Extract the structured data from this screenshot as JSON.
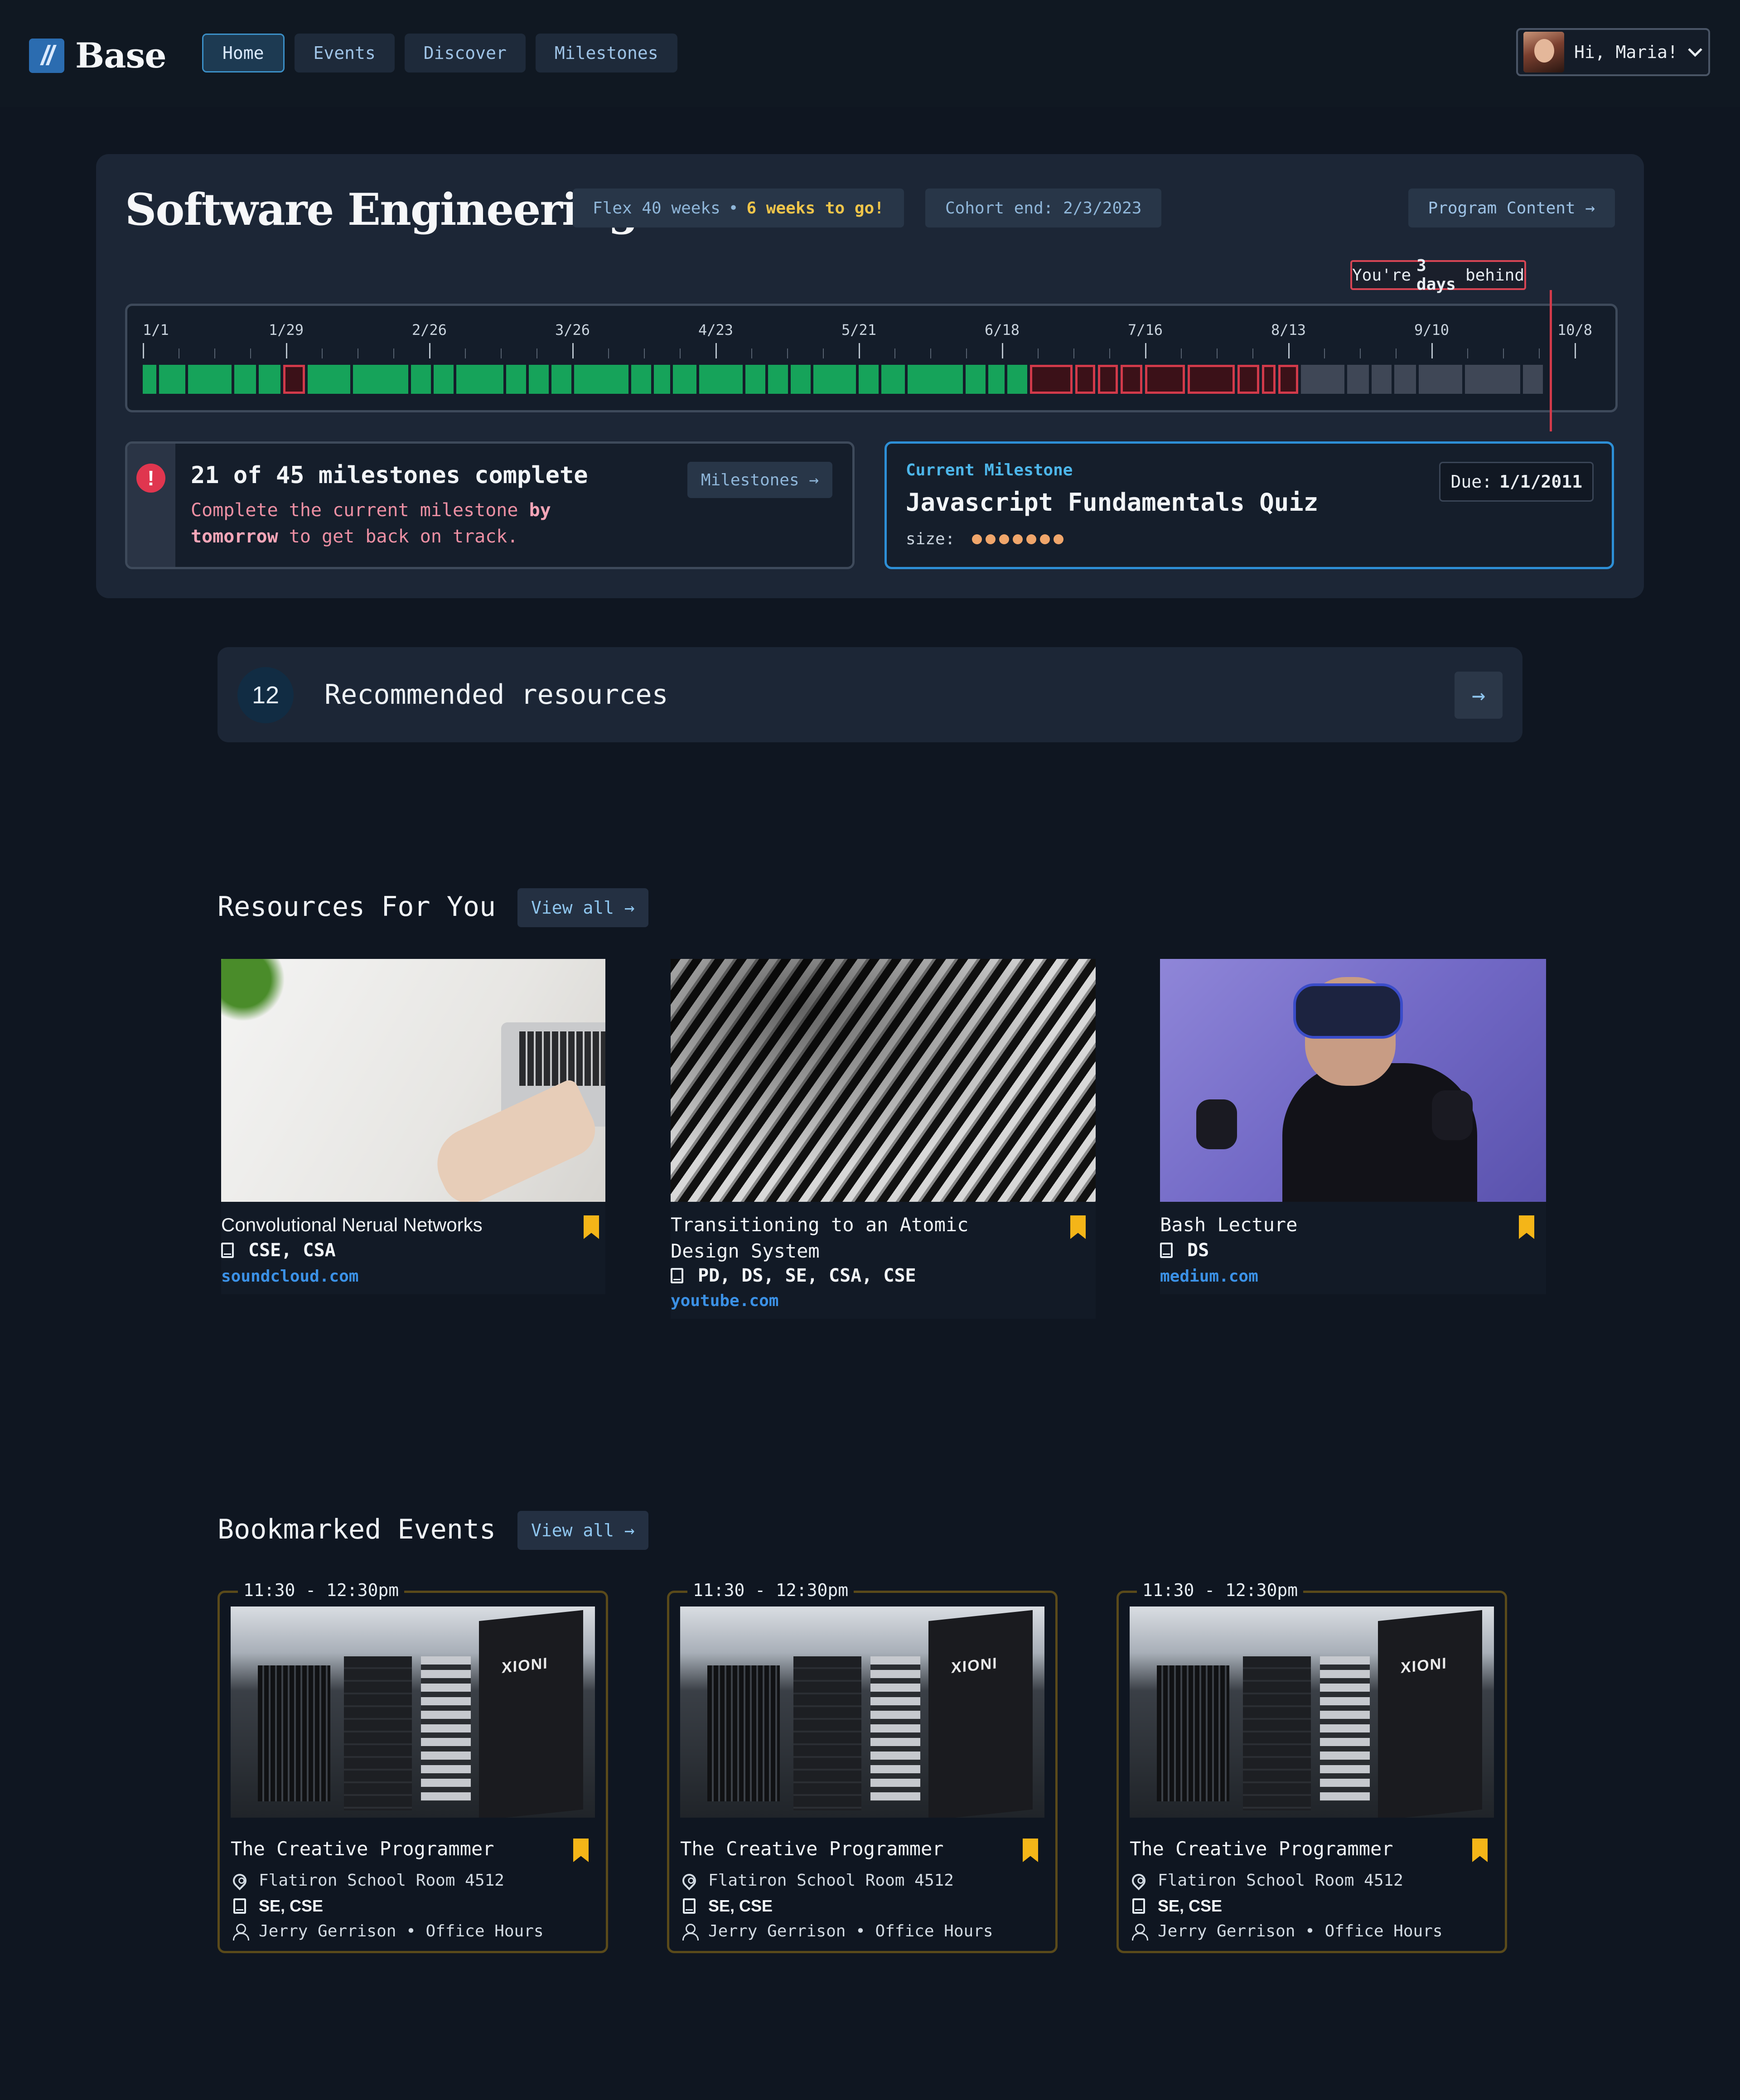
{
  "nav": {
    "logo_mark": "//",
    "logo_text": "Base",
    "tabs": [
      "Home",
      "Events",
      "Discover",
      "Milestones"
    ],
    "active_tab": "Home",
    "greeting": "Hi, Maria!",
    "chevron": "⌄"
  },
  "program": {
    "title": "Software Engineering",
    "flex": "Flex 40 weeks",
    "sep": "•",
    "weeks_left": "6 weeks to go!",
    "cohort_end": "Cohort end: 2/3/2023",
    "content_button": "Program Content →",
    "behind_pre": "You're",
    "behind_days": "3 days",
    "behind_post": "behind",
    "timeline_dates": [
      "1/1",
      "1/29",
      "2/26",
      "3/26",
      "4/23",
      "5/21",
      "6/18",
      "7/16",
      "8/13",
      "9/10",
      "10/8"
    ]
  },
  "milestones": {
    "title": "21 of 45 milestones complete",
    "sub_1": "Complete the current milestone",
    "sub_by": "by",
    "sub_tomorrow": "tomorrow",
    "sub_2": "to get back on track.",
    "button": "Milestones →",
    "alert_icon": "!",
    "completed": 21,
    "total": 45
  },
  "current": {
    "label": "Current Milestone",
    "title": "Javascript Fundamentals Quiz",
    "size_label": "size:",
    "size_value": 7,
    "due_label": "Due:",
    "due_date": "1/1/2011"
  },
  "recommended": {
    "count": "12",
    "label": "Recommended resources",
    "arrow": "→"
  },
  "resources": {
    "heading": "Resources For You",
    "view_all": "View all →",
    "items": [
      {
        "title": "Convolutional Nerual Networks",
        "tags": "CSE, CSA",
        "source": "soundcloud.com"
      },
      {
        "title_1": "Transitioning to an Atomic",
        "title_2": "Design System",
        "tags": "PD, DS, SE, CSA, CSE",
        "source": "youtube.com"
      },
      {
        "title": "Bash Lecture",
        "tags": "DS",
        "source": "medium.com"
      }
    ]
  },
  "events": {
    "heading": "Bookmarked Events",
    "view_all": "View all →",
    "items": [
      {
        "time": "11:30 - 12:30pm",
        "title": "The Creative Programmer",
        "location": "Flatiron School Room 4512",
        "tags": "SE, CSE",
        "host": "Jerry Gerrison • Office Hours"
      },
      {
        "time": "11:30 - 12:30pm",
        "title": "The Creative Programmer",
        "location": "Flatiron School Room 4512",
        "tags": "SE, CSE",
        "host": "Jerry Gerrison • Office Hours"
      },
      {
        "time": "11:30 - 12:30pm",
        "title": "The Creative Programmer",
        "location": "Flatiron School Room 4512",
        "tags": "SE, CSE",
        "host": "Jerry Gerrison • Office Hours"
      }
    ]
  },
  "colors": {
    "background": "#0f1621",
    "card": "#1c2636",
    "accent_blue": "#2d8fd6",
    "done_green": "#16a35a",
    "missed_red": "#d23a4a",
    "bookmark_yellow": "#f4b518",
    "highlight_yellow": "#f0c54a"
  },
  "icons": [
    "logo-icon",
    "chevron-down-icon",
    "alert-icon",
    "arrow-right-icon",
    "book-icon",
    "bookmark-icon",
    "location-pin-icon",
    "person-icon"
  ]
}
